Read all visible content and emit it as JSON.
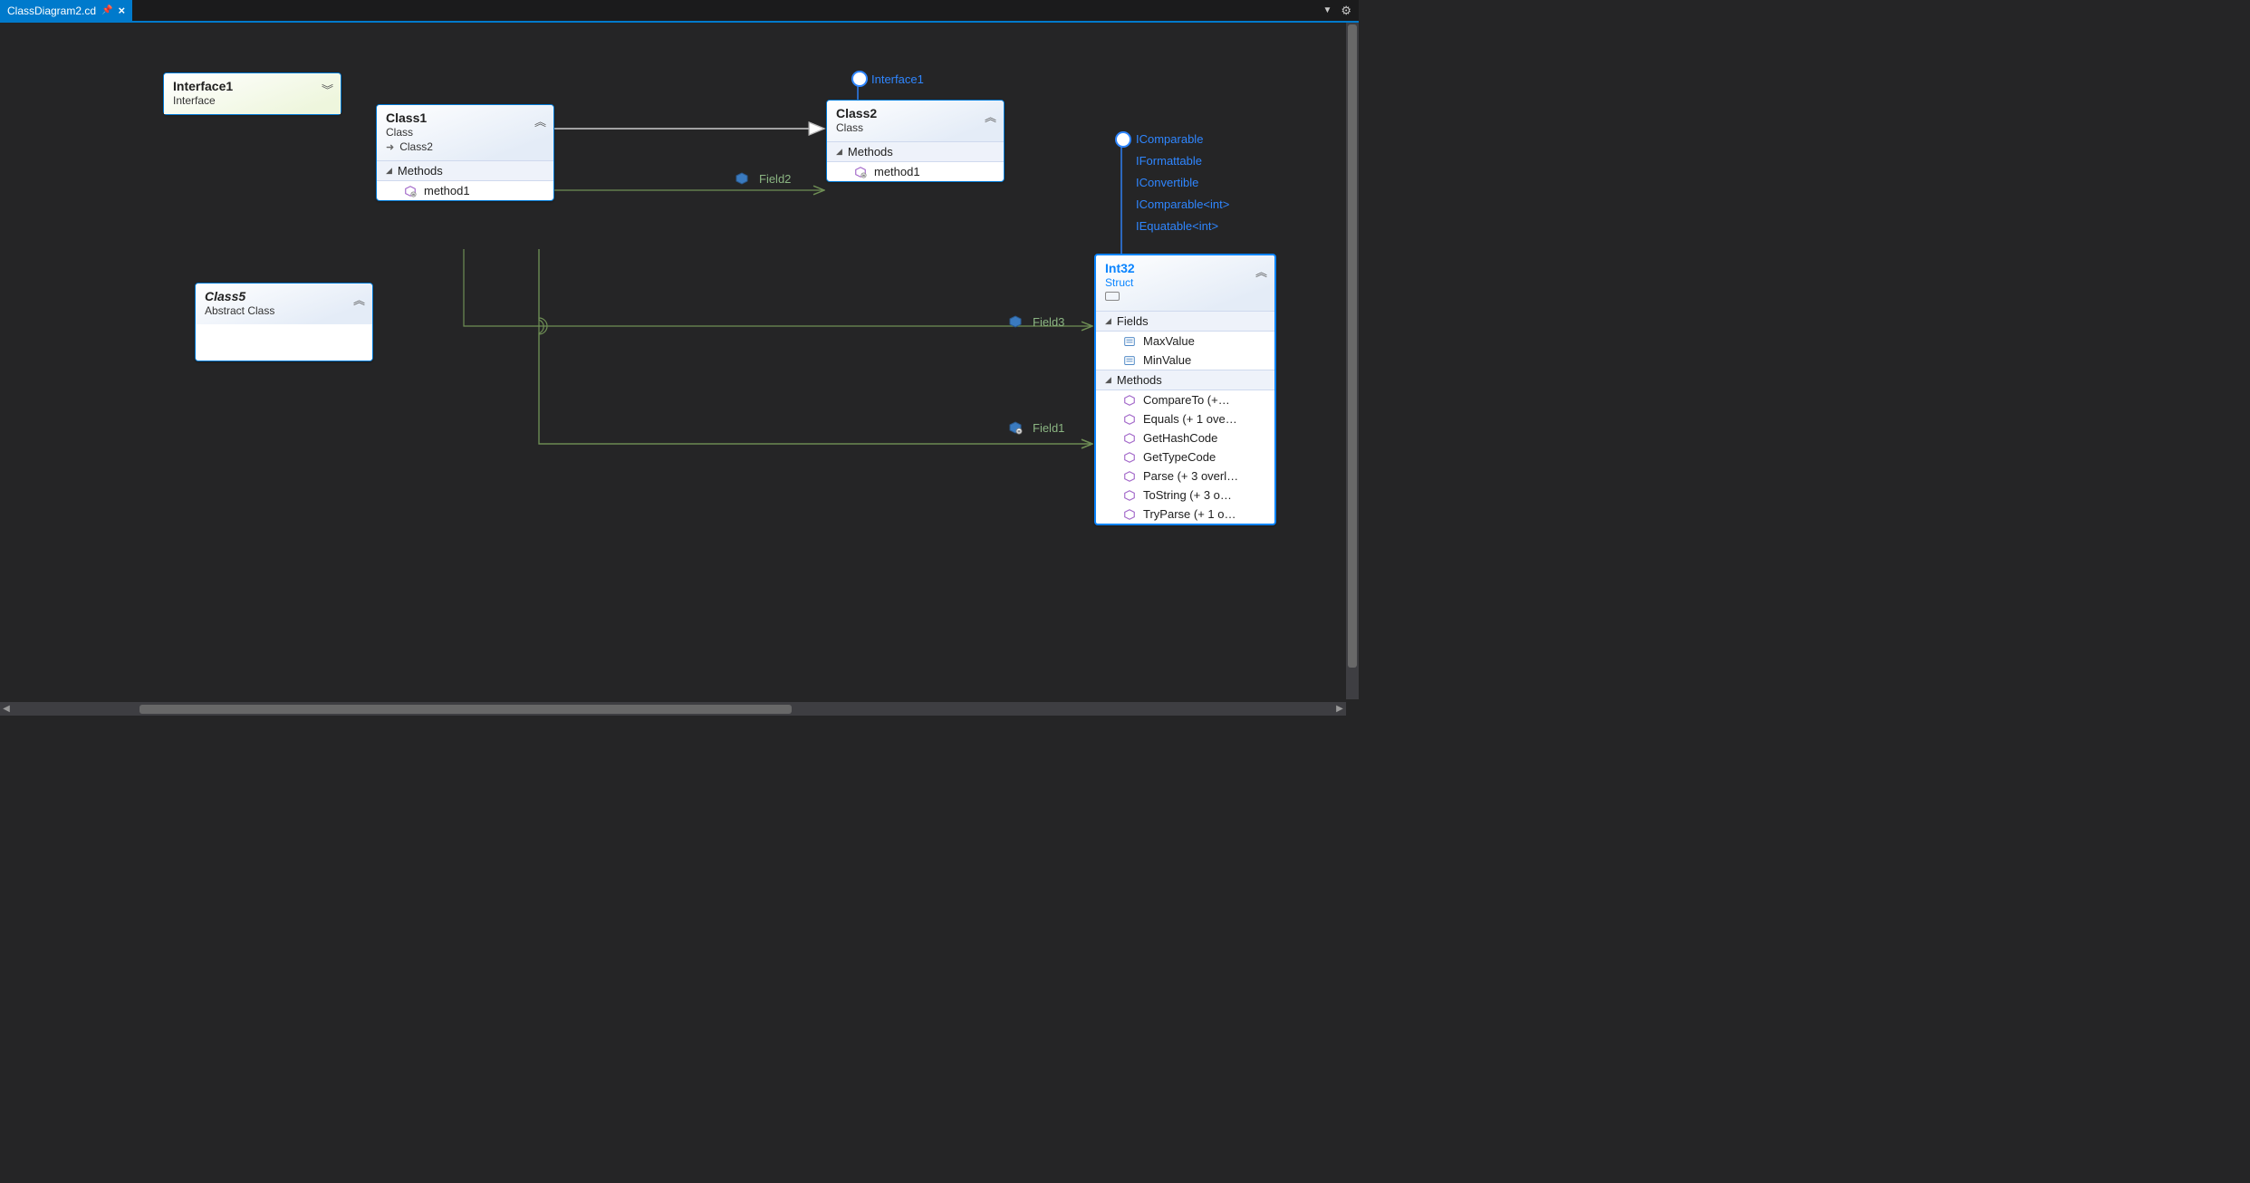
{
  "tab": {
    "title": "ClassDiagram2.cd"
  },
  "canvas": {
    "shapes": {
      "interface1": {
        "name": "Interface1",
        "stereo": "Interface"
      },
      "class1": {
        "name": "Class1",
        "stereo": "Class",
        "derived": "Class2",
        "sections": {
          "methods": "Methods"
        },
        "members": {
          "method1": "method1"
        }
      },
      "class2": {
        "name": "Class2",
        "stereo": "Class",
        "lollipops": [
          "Interface1"
        ],
        "sections": {
          "methods": "Methods"
        },
        "members": {
          "method1": "method1"
        }
      },
      "class5": {
        "name": "Class5",
        "stereo": "Abstract Class"
      },
      "int32": {
        "name": "Int32",
        "stereo": "Struct",
        "lollipops": [
          "IComparable",
          "IFormattable",
          "IConvertible",
          "IComparable<int>",
          "IEquatable<int>"
        ],
        "sections": {
          "fields": "Fields",
          "methods": "Methods"
        },
        "fields": [
          "MaxValue",
          "MinValue"
        ],
        "methods": [
          "CompareTo  (+…",
          "Equals  (+ 1 ove…",
          "GetHashCode",
          "GetTypeCode",
          "Parse  (+ 3 overl…",
          "ToString  (+ 3 o…",
          "TryParse  (+ 1 o…"
        ]
      }
    },
    "associations": {
      "field1": "Field1",
      "field2": "Field2",
      "field3": "Field3"
    }
  }
}
